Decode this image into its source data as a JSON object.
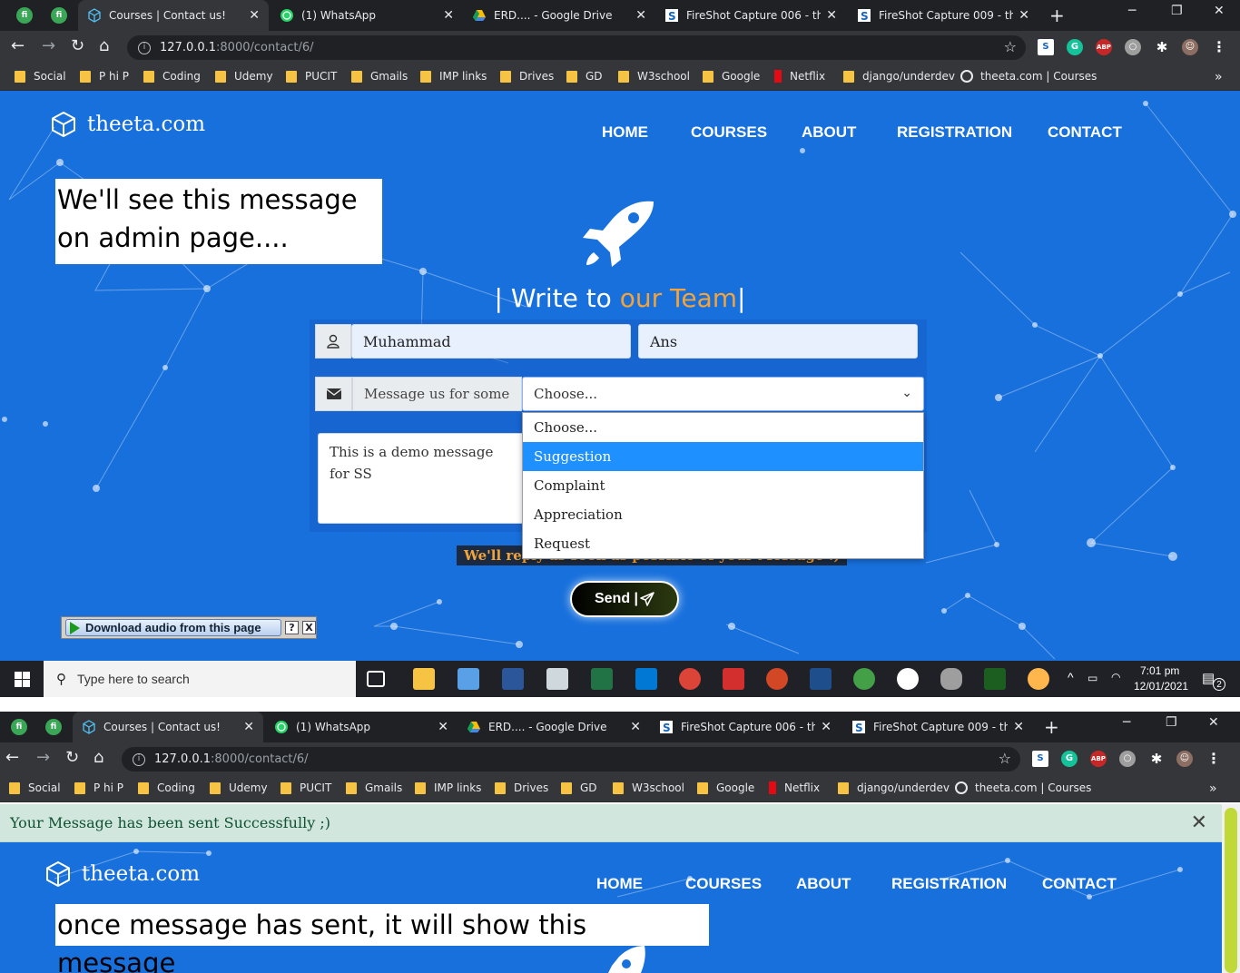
{
  "tabs": [
    {
      "title": "Courses | Contact us!",
      "active": true
    },
    {
      "title": "(1) WhatsApp"
    },
    {
      "title": "ERD.... - Google Drive"
    },
    {
      "title": "FireShot Capture 006 - thee"
    },
    {
      "title": "FireShot Capture 009 - thee"
    }
  ],
  "address": {
    "host": "127.0.0.1",
    "path": ":8000/contact/6/"
  },
  "bookmarks": [
    "Social",
    "P hi P",
    "Coding",
    "Udemy",
    "PUCIT",
    "Gmails",
    "IMP links",
    "Drives",
    "GD",
    "W3school",
    "Google",
    "Netflix",
    "django/underdev",
    "theeta.com | Courses"
  ],
  "site": {
    "brand": "theeta.com",
    "nav": [
      "HOME",
      "COURSES",
      "ABOUT",
      "REGISTRATION",
      "CONTACT"
    ]
  },
  "annotations": {
    "first_line1": "We'll see this message",
    "first_line2": "on admin page....",
    "second": "once message has sent, it will show this message"
  },
  "form": {
    "heading_prefix": "| Write to ",
    "heading_accent": "our Team",
    "heading_suffix": "|",
    "first_name": "Muhammad",
    "last_name": "Ans",
    "message_label": "Message us for some",
    "select_value": "Choose...",
    "options": [
      "Choose...",
      "Suggestion",
      "Complaint",
      "Appreciation",
      "Request"
    ],
    "highlighted_option": "Suggestion",
    "message_line1": "This is a demo message",
    "message_line2": "for SS",
    "reply_note": "We'll reply as soon as possible of your Message :)",
    "send_label": "Send |"
  },
  "extension": {
    "label": "Download audio from this page",
    "help": "?",
    "close": "X"
  },
  "taskbar": {
    "search_placeholder": "Type here to search",
    "time": "7:01 pm",
    "date": "12/01/2021",
    "notifications": "2"
  },
  "alert": {
    "message": "Your Message has been sent Successfully ;)"
  },
  "colors": {
    "page_bg": "#1870dc",
    "accent": "#f2a33a",
    "alert_bg": "#d1e7dd",
    "option_highlight": "#1e90ff"
  }
}
